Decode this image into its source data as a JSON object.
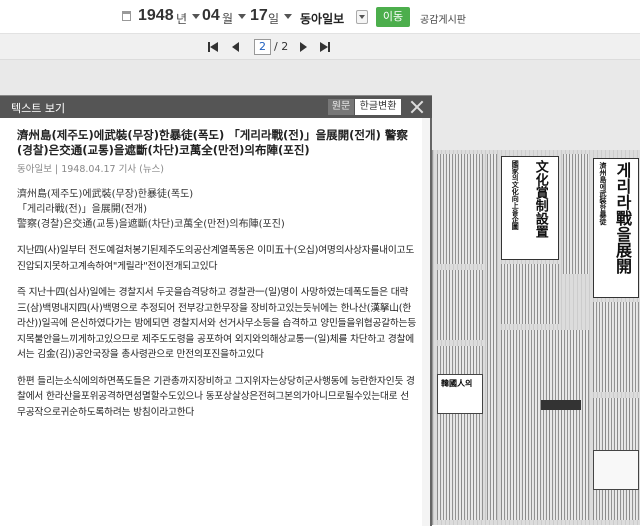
{
  "toolbar": {
    "year": "1948",
    "year_unit": "년",
    "month": "04",
    "month_unit": "월",
    "day": "17",
    "day_unit": "일",
    "newspaper": "동아일보",
    "go_label": "이동",
    "publisher_link": "공감게시판"
  },
  "pager": {
    "current_page": "2",
    "total": "/ 2"
  },
  "panel": {
    "title": "텍스트 보기",
    "tab_original": "원문",
    "tab_hangul": "한글변환"
  },
  "article": {
    "title": "濟州島(제주도)에武裝(무장)한暴徒(폭도) 「게리라戰(전)」을展開(전개) 警察(경찰)은交通(교통)을遮斷(차단)코萬全(만전)의布陣(포진)",
    "meta": "동아일보 | 1948.04.17 기사 (뉴스)",
    "headline_1": "濟州島(제주도)에武裝(무장)한暴徒(폭도)",
    "headline_2": "「게리라戰(전)」을展開(전개)",
    "headline_3": "警察(경찰)은交通(교통)을遮斷(차단)코萬全(만전)의布陣(포진)",
    "para_1": "지난四(사)일부터 전도예걸처봉기된제주도의공산계열폭동은 이미五十(오십)여명의사상자를내이고도 진압되지못하고계속하여\"게릴라\"전이전개되고있다",
    "para_2": "즉 지난十四(십사)일에는 경찰지서 두곳을습격당하고 경찰관一(일)명이 사망하였는데폭도들은 대략三(삼)백명내지四(사)백명으로 추정되어 전부강고한무장을 장비하고있는듯뉘에는 한나산(漢拏山(한라산))일곡에 은신하였다가는 밤에되면 경찰지서와 선거사무소등을 습격하고 양민들을위협공갈하는등 지목불안을느끼게하고있으므로 제주도도령을 공포하여 외지와의해상교통一(일)체를 차단하고 경찰에서는 김金(김))공안국장을 총사령관으로 만전의포진을하고있다",
    "para_3": "한편 들리는소식에의하면폭도들은 기관총까지장비하고 그지위자는상당히군사행동에 능란한자인듯 경찰에서 한라산을포위공격하면섬멸할수도있으나 동포상살상은전혀그본의가아니므로될수있는대로 선무공작으로귀순하도록하려는 방침이라고한다"
  },
  "newspaper_image": {
    "masthead": "濟州島에武裝한暴徒",
    "headline_large": "게리라戰을展開",
    "culture_headline": "文化賞制設置",
    "culture_sub": "國家의文化向上을企圖",
    "box_label": "韓國人의"
  }
}
